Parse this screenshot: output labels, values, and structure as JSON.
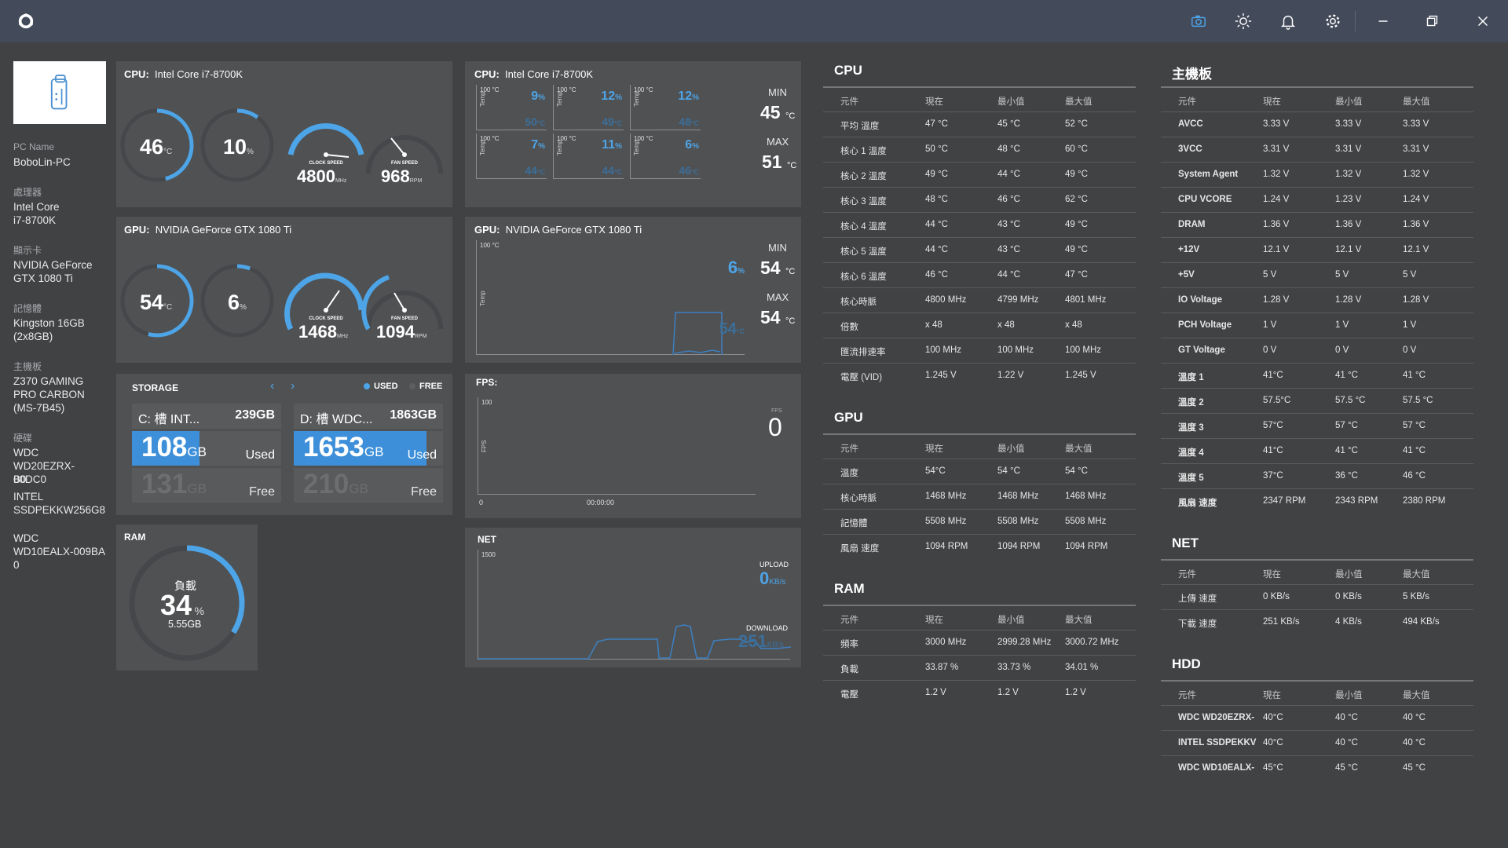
{
  "titlebar": {
    "icons": [
      "camera-icon",
      "brightness-icon",
      "bell-icon",
      "gear-icon",
      "minimize-icon",
      "restore-icon",
      "close-icon"
    ]
  },
  "sidebar": {
    "pc_name_label": "PC Name",
    "pc_name": "BoboLin-PC",
    "cpu_label": "處理器",
    "cpu_line1": "Intel Core",
    "cpu_line2": "i7-8700K",
    "gpu_label": "顯示卡",
    "gpu_line1": "NVIDIA GeForce",
    "gpu_line2": "GTX 1080 Ti",
    "mem_label": "記憶體",
    "mem_line1": "Kingston 16GB",
    "mem_line2": "(2x8GB)",
    "mb_label": "主機板",
    "mb_line1": "Z370 GAMING",
    "mb_line2": "PRO CARBON",
    "mb_line3": "(MS-7B45)",
    "hdd_label": "硬碟",
    "hdd1_line1": "WDC",
    "hdd1_line2": "WD20EZRX-00DC0",
    "hdd1_line3": "B0",
    "hdd2_line1": "INTEL",
    "hdd2_line2": "SSDPEKKW256G8",
    "hdd3_line1": "WDC",
    "hdd3_line2": "WD10EALX-009BA",
    "hdd3_line3": "0"
  },
  "cpu_gauges": {
    "label": "CPU:",
    "name": "Intel Core i7-8700K",
    "temp": "46",
    "temp_unit": "°C",
    "temp_fraction": 0.46,
    "load": "10",
    "load_unit": "%",
    "load_fraction": 0.1,
    "clock": "4800",
    "clock_unit": "MHz",
    "clock_label": "CLOCK SPEED",
    "fan": "968",
    "fan_unit": "RPM",
    "fan_label": "FAN SPEED"
  },
  "gpu_gauges": {
    "label": "GPU:",
    "name": "NVIDIA GeForce GTX 1080 Ti",
    "temp": "54",
    "temp_unit": "°C",
    "temp_fraction": 0.54,
    "load": "6",
    "load_unit": "%",
    "load_fraction": 0.06,
    "clock": "1468",
    "clock_unit": "MHz",
    "clock_label": "CLOCK SPEED",
    "fan": "1094",
    "fan_unit": "RPM",
    "fan_label": "FAN SPEED"
  },
  "cpu_cores": {
    "label": "CPU:",
    "name": "Intel Core i7-8700K",
    "scale": "100 °C",
    "axis": "Temp",
    "cores": [
      {
        "pct": "9",
        "temp": "50"
      },
      {
        "pct": "12",
        "temp": "49"
      },
      {
        "pct": "12",
        "temp": "48"
      },
      {
        "pct": "7",
        "temp": "44"
      },
      {
        "pct": "11",
        "temp": "44"
      },
      {
        "pct": "6",
        "temp": "46"
      }
    ],
    "pct_unit": "%",
    "temp_unit": "°C",
    "min_label": "MIN",
    "min": "45",
    "max_label": "MAX",
    "max": "51",
    "unit": "°C"
  },
  "gpu_chart": {
    "label": "GPU:",
    "name": "NVIDIA GeForce GTX 1080 Ti",
    "scale": "100 °C",
    "axis": "Temp",
    "pct": "6",
    "pct_unit": "%",
    "temp": "54",
    "temp_unit": "°C",
    "min_label": "MIN",
    "min": "54",
    "max_label": "MAX",
    "max": "54",
    "unit": "°C"
  },
  "storage": {
    "title": "STORAGE",
    "legend_used": "USED",
    "legend_free": "FREE",
    "drives": [
      {
        "name": "C: 槽 INT...",
        "size": "239GB",
        "used": "108",
        "free": "131",
        "used_fraction": 0.45
      },
      {
        "name": "D: 槽 WDC...",
        "size": "1863GB",
        "used": "1653",
        "free": "210",
        "used_fraction": 0.89
      }
    ],
    "unit": "GB",
    "used_label": "Used",
    "free_label": "Free"
  },
  "fps": {
    "title": "FPS:",
    "scale": "100",
    "axis": "FPS",
    "x0": "0",
    "time": "00:00:00",
    "fps_label": "FPS",
    "value": "0"
  },
  "ram": {
    "title": "RAM",
    "load_label": "負載",
    "value": "34",
    "unit": "%",
    "size": "5.55GB",
    "fraction": 0.34
  },
  "net": {
    "title": "NET",
    "scale": "1500",
    "upload_label": "UPLOAD",
    "upload": "0",
    "download_label": "DOWNLOAD",
    "download": "251",
    "unit": "KB/s"
  },
  "tables": {
    "headers": [
      "元件",
      "現在",
      "最小值",
      "最大值"
    ],
    "cpu": {
      "title": "CPU",
      "rows": [
        [
          "平均 溫度",
          "47 °C",
          "45 °C",
          "52 °C"
        ],
        [
          "核心 1 溫度",
          "50 °C",
          "48 °C",
          "60 °C"
        ],
        [
          "核心 2 溫度",
          "49 °C",
          "44 °C",
          "49 °C"
        ],
        [
          "核心 3 溫度",
          "48 °C",
          "46 °C",
          "62 °C"
        ],
        [
          "核心 4 溫度",
          "44 °C",
          "43 °C",
          "49 °C"
        ],
        [
          "核心 5 溫度",
          "44 °C",
          "43 °C",
          "49 °C"
        ],
        [
          "核心 6 溫度",
          "46 °C",
          "44 °C",
          "47 °C"
        ],
        [
          "核心時脈",
          "4800 MHz",
          "4799 MHz",
          "4801 MHz"
        ],
        [
          "倍數",
          "x 48",
          "x 48",
          "x 48"
        ],
        [
          "匯流排速率",
          "100 MHz",
          "100 MHz",
          "100 MHz"
        ],
        [
          "電壓 (VID)",
          "1.245 V",
          "1.22 V",
          "1.245 V"
        ]
      ]
    },
    "gpu": {
      "title": "GPU",
      "rows": [
        [
          "溫度",
          "54°C",
          "54 °C",
          "54 °C"
        ],
        [
          "核心時脈",
          "1468 MHz",
          "1468 MHz",
          "1468 MHz"
        ],
        [
          "記憶體",
          "5508 MHz",
          "5508 MHz",
          "5508 MHz"
        ],
        [
          "風扇 速度",
          "1094 RPM",
          "1094 RPM",
          "1094 RPM"
        ]
      ]
    },
    "ram": {
      "title": "RAM",
      "rows": [
        [
          "頻率",
          "3000 MHz",
          "2999.28 MHz",
          "3000.72 MHz"
        ],
        [
          "負載",
          "33.87 %",
          "33.73 %",
          "34.01 %"
        ],
        [
          "電壓",
          "1.2 V",
          "1.2 V",
          "1.2 V"
        ]
      ]
    },
    "mb": {
      "title": "主機板",
      "rows": [
        [
          "AVCC",
          "3.33 V",
          "3.33 V",
          "3.33 V"
        ],
        [
          "3VCC",
          "3.31 V",
          "3.31 V",
          "3.31 V"
        ],
        [
          "System Agent",
          "1.32 V",
          "1.32 V",
          "1.32 V"
        ],
        [
          "CPU VCORE",
          "1.24 V",
          "1.23 V",
          "1.24 V"
        ],
        [
          "DRAM",
          "1.36 V",
          "1.36 V",
          "1.36 V"
        ],
        [
          "+12V",
          "12.1 V",
          "12.1 V",
          "12.1 V"
        ],
        [
          "+5V",
          "5 V",
          "5 V",
          "5 V"
        ],
        [
          "IO Voltage",
          "1.28 V",
          "1.28 V",
          "1.28 V"
        ],
        [
          "PCH Voltage",
          "1 V",
          "1 V",
          "1 V"
        ],
        [
          "GT Voltage",
          "0 V",
          "0 V",
          "0 V"
        ],
        [
          "溫度 1",
          "41°C",
          "41 °C",
          "41 °C"
        ],
        [
          "溫度 2",
          "57.5°C",
          "57.5 °C",
          "57.5 °C"
        ],
        [
          "溫度 3",
          "57°C",
          "57 °C",
          "57 °C"
        ],
        [
          "溫度 4",
          "41°C",
          "41 °C",
          "41 °C"
        ],
        [
          "溫度 5",
          "37°C",
          "36 °C",
          "46 °C"
        ],
        [
          "風扇 速度",
          "2347 RPM",
          "2343 RPM",
          "2380 RPM"
        ]
      ]
    },
    "net": {
      "title": "NET",
      "rows": [
        [
          "上傳 速度",
          "0 KB/s",
          "0 KB/s",
          "5 KB/s"
        ],
        [
          "下載 速度",
          "251 KB/s",
          "4 KB/s",
          "494 KB/s"
        ]
      ]
    },
    "hdd": {
      "title": "HDD",
      "rows": [
        [
          "WDC WD20EZRX-",
          "40°C",
          "40 °C",
          "40 °C"
        ],
        [
          "INTEL SSDPEKKV",
          "40°C",
          "40 °C",
          "40 °C"
        ],
        [
          "WDC WD10EALX-",
          "45°C",
          "45 °C",
          "45 °C"
        ]
      ]
    }
  },
  "colors": {
    "accent": "#4da4e6",
    "titlebar": "#434a5a",
    "background": "#414244",
    "panel": "#505153"
  }
}
